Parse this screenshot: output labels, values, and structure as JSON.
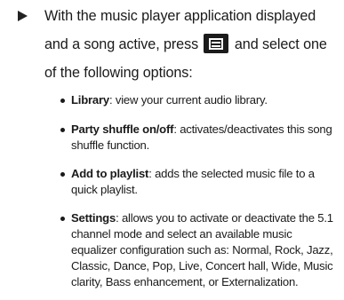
{
  "step": {
    "intro_part1": "With the music player application displayed and a song active, press",
    "menu_key_icon": "menu-key-icon",
    "intro_part2": "and select one of the following options:"
  },
  "options": [
    {
      "term": "Library",
      "desc": ": view your current audio library."
    },
    {
      "term": "Party shuffle on/off",
      "desc": ": activates/deactivates this song shuffle function."
    },
    {
      "term": "Add to playlist",
      "desc": ": adds the selected music file to a quick playlist."
    },
    {
      "term": "Settings",
      "desc": ": allows you to activate or deactivate the 5.1 channel mode and select an available music equalizer configuration such as: Normal, Rock, Jazz, Classic, Dance, Pop, Live, Concert hall, Wide, Music clarity, Bass enhancement, or Externalization."
    }
  ]
}
